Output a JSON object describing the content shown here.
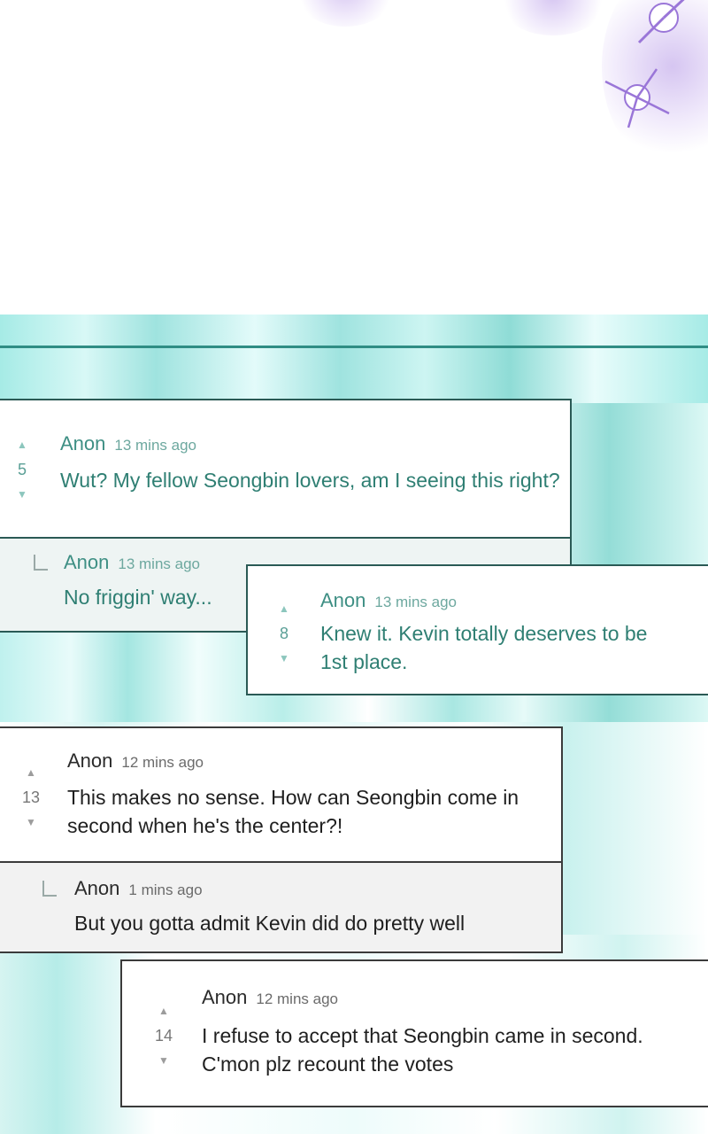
{
  "comments": [
    {
      "author": "Anon",
      "time": "13 mins ago",
      "votes": "5",
      "text": "Wut? My fellow Seongbin lovers, am I seeing this right?",
      "reply": {
        "author": "Anon",
        "time": "13 mins ago",
        "text": "No friggin' way..."
      }
    },
    {
      "author": "Anon",
      "time": "13 mins ago",
      "votes": "8",
      "text": "Knew it. Kevin totally deserves to be 1st place."
    },
    {
      "author": "Anon",
      "time": "12 mins ago",
      "votes": "13",
      "text": "This makes no sense. How can Seongbin come in second when he's the center?!",
      "reply": {
        "author": "Anon",
        "time": "1 mins ago",
        "text": "But you gotta admit Kevin did do pretty well"
      }
    },
    {
      "author": "Anon",
      "time": "12 mins ago",
      "votes": "14",
      "text": "I refuse to accept that Seongbin came in second. C'mon plz recount the votes"
    }
  ],
  "theme": {
    "teal_text": "#2f7f73",
    "teal_border": "#2a5a55",
    "band_color": "#9fe3df",
    "sparkle_color": "#b496e6"
  },
  "icons": {
    "upvote": "triangle-up-icon",
    "downvote": "triangle-down-icon",
    "reply": "reply-corner-icon",
    "sparkle": "sparkle-star-icon"
  }
}
